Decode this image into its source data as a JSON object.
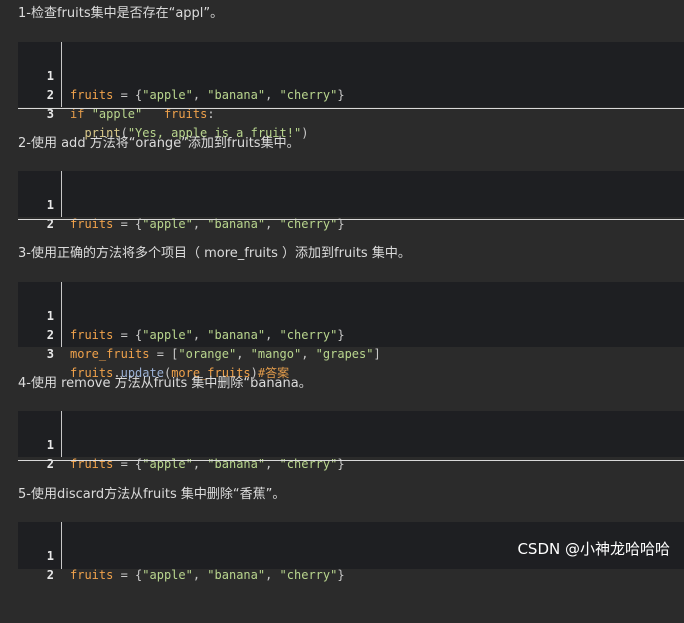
{
  "questions": [
    {
      "title": "1-检查fruits集中是否存在“appl”。",
      "lines": [
        {
          "num": "1",
          "text": "fruits = {\"apple\", \"banana\", \"cherry\"}"
        },
        {
          "num": "2",
          "text": "if \"apple\"   fruits:"
        },
        {
          "num": "3",
          "text": "  print(\"Yes, apple is a fruit!\")"
        }
      ]
    },
    {
      "title": "2-使用 add 方法将“orange”添加到fruits集中。",
      "lines": [
        {
          "num": "1",
          "text": "fruits = {\"apple\", \"banana\", \"cherry\"}"
        },
        {
          "num": "2",
          "text": ""
        }
      ]
    },
    {
      "title": "3-使用正确的方法将多个项目（ more_fruits ）添加到fruits 集中。",
      "lines": [
        {
          "num": "1",
          "text": "fruits = {\"apple\", \"banana\", \"cherry\"}"
        },
        {
          "num": "2",
          "text": "more_fruits = [\"orange\", \"mango\", \"grapes\"]"
        },
        {
          "num": "3",
          "text": "fruits.update(more_fruits)#答案"
        }
      ]
    },
    {
      "title": "4-使用 remove 方法从fruits 集中删除“banana。",
      "lines": [
        {
          "num": "1",
          "text": "fruits = {\"apple\", \"banana\", \"cherry\"}"
        },
        {
          "num": "2",
          "text": ""
        }
      ]
    },
    {
      "title": "5-使用discard方法从fruits 集中删除“香蕉”。",
      "lines": [
        {
          "num": "1",
          "text": "fruits = {\"apple\", \"banana\", \"cherry\"}"
        },
        {
          "num": "2",
          "text": ""
        }
      ]
    }
  ],
  "watermark": "CSDN @小神龙哈哈哈",
  "colors": {
    "background": "#2b2b2b",
    "code_background": "#1e1f22",
    "variable": "#f0a24b",
    "string": "#b9d68e",
    "keyword": "#e39c4b"
  }
}
